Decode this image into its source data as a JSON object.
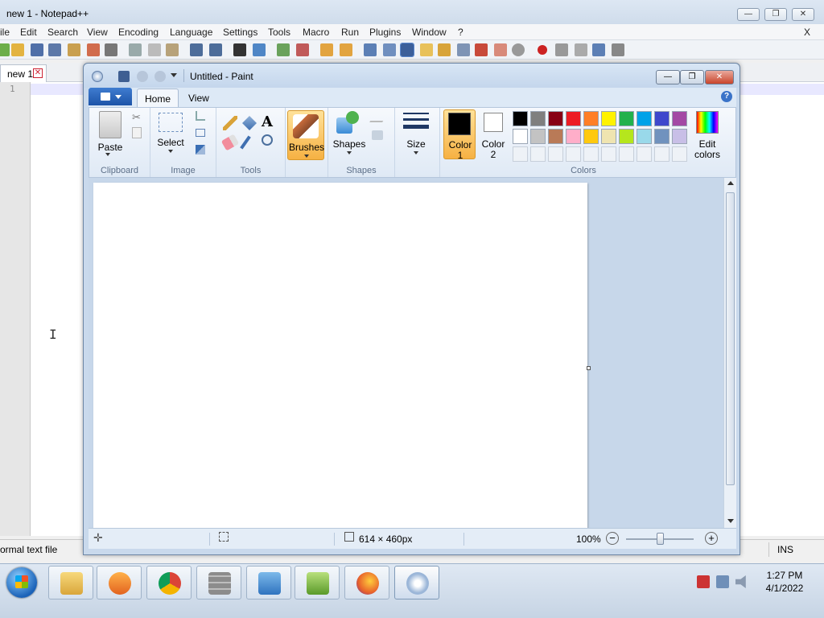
{
  "notepadpp": {
    "title": "new 1 - Notepad++",
    "menu": [
      "ile",
      "Edit",
      "Search",
      "View",
      "Encoding",
      "Language",
      "Settings",
      "Tools",
      "Macro",
      "Run",
      "Plugins",
      "Window",
      "?"
    ],
    "menu_close": "X",
    "tab_label": "new 1",
    "tab_close": "✕",
    "line_number": "1",
    "status_left": "ormal text file",
    "status_right": "INS",
    "window_buttons": {
      "min": "—",
      "max": "❐",
      "close": "✕"
    }
  },
  "paint": {
    "title": "Untitled - Paint",
    "tabs": {
      "home": "Home",
      "view": "View"
    },
    "help": "?",
    "window_buttons": {
      "min": "—",
      "max": "❐",
      "close": "✕"
    },
    "ribbon": {
      "clipboard": {
        "paste": "Paste",
        "group": "Clipboard"
      },
      "image": {
        "select": "Select",
        "group": "Image"
      },
      "tools": {
        "group": "Tools"
      },
      "brushes": "Brushes",
      "shapes": {
        "label": "Shapes",
        "group": "Shapes"
      },
      "size": "Size",
      "color1": {
        "line1": "Color",
        "line2": "1"
      },
      "color2": {
        "line1": "Color",
        "line2": "2"
      },
      "colors_group": "Colors",
      "edit_colors": {
        "line1": "Edit",
        "line2": "colors"
      }
    },
    "palette_row1": [
      "#000000",
      "#7f7f7f",
      "#880015",
      "#ed1c24",
      "#ff7f27",
      "#fff200",
      "#22b14c",
      "#00a2e8",
      "#3f48cc",
      "#a349a4"
    ],
    "palette_row2": [
      "#ffffff",
      "#c3c3c3",
      "#b97a57",
      "#ffaec9",
      "#ffc90e",
      "#efe4b0",
      "#b5e61d",
      "#99d9ea",
      "#7092be",
      "#c8bfe7"
    ],
    "color1_value": "#000000",
    "color2_value": "#ffffff",
    "status": {
      "dimensions": "614 × 460px",
      "zoom": "100%"
    }
  },
  "taskbar": {
    "time": "1:27 PM",
    "date": "4/1/2022"
  }
}
